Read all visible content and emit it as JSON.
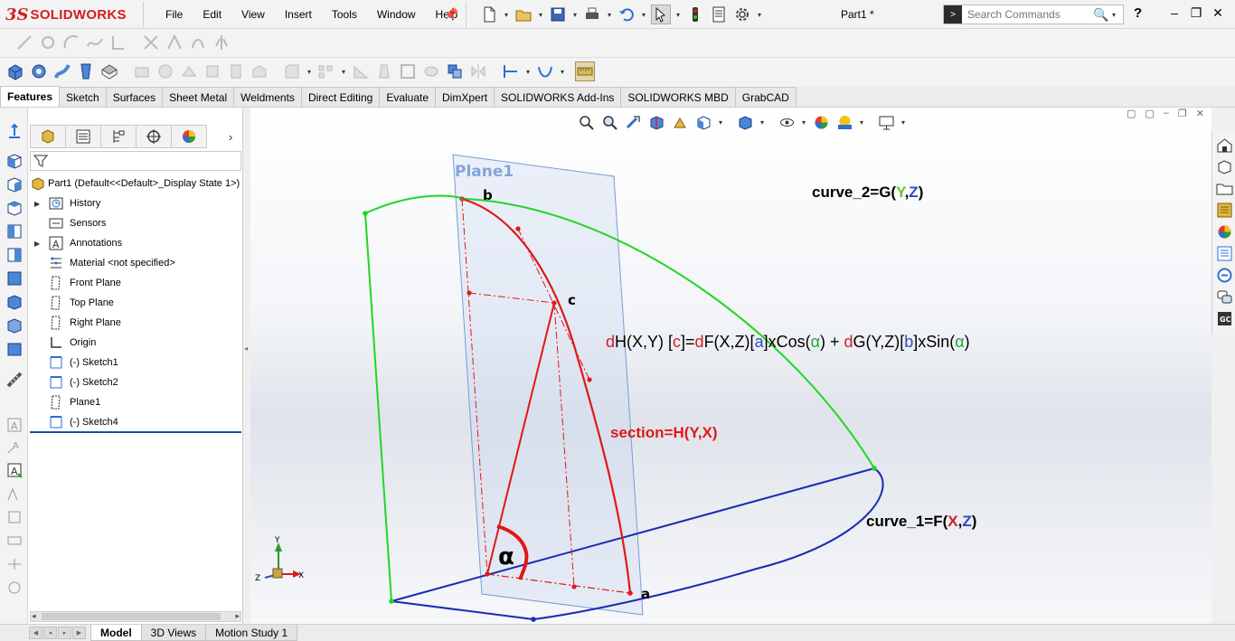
{
  "app": {
    "brand_prefix": "3S",
    "brand_name": "SOLIDWORKS",
    "doc_title": "Part1 *"
  },
  "menu": [
    "File",
    "Edit",
    "View",
    "Insert",
    "Tools",
    "Window",
    "Help"
  ],
  "search": {
    "placeholder": "Search Commands"
  },
  "help_label": "?",
  "command_tabs": [
    {
      "label": "Features",
      "active": true
    },
    {
      "label": "Sketch"
    },
    {
      "label": "Surfaces"
    },
    {
      "label": "Sheet Metal"
    },
    {
      "label": "Weldments"
    },
    {
      "label": "Direct Editing"
    },
    {
      "label": "Evaluate"
    },
    {
      "label": "DimXpert"
    },
    {
      "label": "SOLIDWORKS Add-Ins"
    },
    {
      "label": "SOLIDWORKS MBD"
    },
    {
      "label": "GrabCAD"
    }
  ],
  "tree": {
    "root": "Part1  (Default<<Default>_Display State 1>)",
    "items": [
      {
        "label": "History",
        "icon": "history-icon",
        "expandable": true
      },
      {
        "label": "Sensors",
        "icon": "sensors-icon",
        "expandable": false
      },
      {
        "label": "Annotations",
        "icon": "annotations-icon",
        "expandable": true
      },
      {
        "label": "Material <not specified>",
        "icon": "material-icon",
        "expandable": false
      },
      {
        "label": "Front Plane",
        "icon": "plane-icon",
        "expandable": false
      },
      {
        "label": "Top Plane",
        "icon": "plane-icon",
        "expandable": false
      },
      {
        "label": "Right Plane",
        "icon": "plane-icon",
        "expandable": false
      },
      {
        "label": "Origin",
        "icon": "origin-icon",
        "expandable": false
      },
      {
        "label": "(-) Sketch1",
        "icon": "sketch-icon",
        "expandable": false
      },
      {
        "label": "(-) Sketch2",
        "icon": "sketch-icon",
        "expandable": false
      },
      {
        "label": "Plane1",
        "icon": "plane-icon",
        "expandable": false
      },
      {
        "label": "(-) Sketch4",
        "icon": "sketch-icon",
        "expandable": false
      }
    ]
  },
  "bottom_tabs": [
    {
      "label": "Model",
      "active": true
    },
    {
      "label": "3D Views"
    },
    {
      "label": "Motion Study 1"
    }
  ],
  "scene": {
    "plane_label": "Plane1",
    "point_a": "a",
    "point_b": "b",
    "point_c": "c",
    "angle_symbol": "α",
    "curve2": {
      "prefix": "curve_2=G(",
      "v1": "Y",
      "sep": ",",
      "v2": "Z",
      "suffix": ")"
    },
    "curve1": {
      "prefix": "curve_1=F(",
      "v1": "X",
      "sep": ",",
      "v2": "Z",
      "suffix": ")"
    },
    "section_label": "section=H(Y,X)",
    "equation": [
      {
        "t": "d",
        "c": "#d11f1f"
      },
      {
        "t": "H(X,Y) [",
        "c": "#000"
      },
      {
        "t": "c",
        "c": "#d11f1f"
      },
      {
        "t": "]=",
        "c": "#000"
      },
      {
        "t": "d",
        "c": "#d11f1f"
      },
      {
        "t": "F(X,Z)[",
        "c": "#000"
      },
      {
        "t": "a",
        "c": "#2f48c4"
      },
      {
        "t": "]xCos(",
        "c": "#000"
      },
      {
        "t": "α",
        "c": "#2aa52a"
      },
      {
        "t": ") + ",
        "c": "#000"
      },
      {
        "t": "d",
        "c": "#d11f1f"
      },
      {
        "t": "G(Y,Z)[",
        "c": "#000"
      },
      {
        "t": "b",
        "c": "#2f48c4"
      },
      {
        "t": "]xSin(",
        "c": "#000"
      },
      {
        "t": "α",
        "c": "#2aa52a"
      },
      {
        "t": ")",
        "c": "#000"
      }
    ],
    "triad": {
      "y": "Y",
      "z": "Z",
      "x": "X"
    }
  },
  "colors": {
    "curve_green": "#22d622",
    "curve_blue": "#1a2bb3",
    "section_red": "#e01818",
    "plane_fill": "#c9d7f0",
    "plane_edge": "#7a9bd6",
    "label_x": "#d11f1f",
    "label_y": "#6cc72a",
    "label_z": "#2f48c4"
  }
}
